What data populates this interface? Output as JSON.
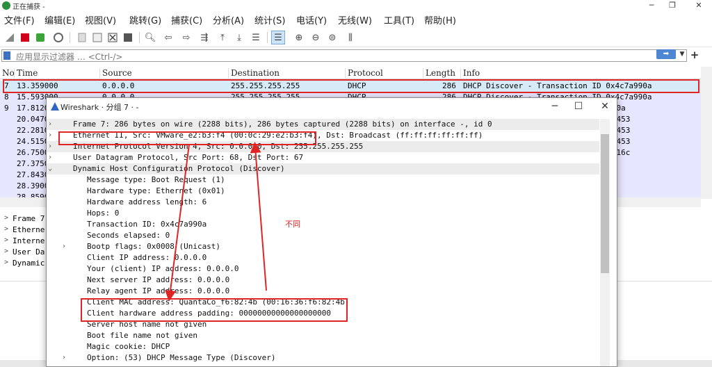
{
  "window": {
    "title": "正在捕获 -"
  },
  "menu": [
    {
      "label": "文件(F)"
    },
    {
      "label": "编辑(E)"
    },
    {
      "label": "视图(V)"
    },
    {
      "label": "跳转(G)"
    },
    {
      "label": "捕获(C)"
    },
    {
      "label": "分析(A)"
    },
    {
      "label": "统计(S)"
    },
    {
      "label": "电话(Y)"
    },
    {
      "label": "无线(W)"
    },
    {
      "label": "工具(T)"
    },
    {
      "label": "帮助(H)"
    }
  ],
  "filter": {
    "placeholder": "应用显示过滤器 … <Ctrl-/>"
  },
  "packet_list": {
    "columns": [
      "No",
      "Time",
      "Source",
      "Destination",
      "Protocol",
      "Length",
      "Info"
    ],
    "rows": [
      {
        "no": "7",
        "time": "13.359000",
        "src": "0.0.0.0",
        "dst": "255.255.255.255",
        "proto": "DHCP",
        "len": "286",
        "info": "DHCP Discover - Transaction ID 0x4c7a990a"
      },
      {
        "no": "8",
        "time": "15.593000",
        "src": "0.0.0.0",
        "dst": "255.255.255.255",
        "proto": "DHCP",
        "len": "286",
        "info": "DHCP Discover - Transaction ID 0x4c7a990a"
      },
      {
        "no": "9",
        "time": "17.8120",
        "src": "",
        "dst": "",
        "proto": "",
        "len": "",
        "info": "7a990a"
      },
      {
        "no": "",
        "time": "20.0470",
        "src": "",
        "dst": "",
        "proto": "",
        "len": "",
        "info": "54d3453"
      },
      {
        "no": "",
        "time": "22.2810",
        "src": "",
        "dst": "",
        "proto": "",
        "len": "",
        "info": "54d3453"
      },
      {
        "no": "",
        "time": "24.5150",
        "src": "",
        "dst": "",
        "proto": "",
        "len": "",
        "info": "54d3453"
      },
      {
        "no": "",
        "time": "26.7500",
        "src": "",
        "dst": "",
        "proto": "",
        "len": "",
        "info": "1c1416c"
      },
      {
        "no": "",
        "time": "27.3750",
        "src": "",
        "dst": "",
        "proto": "",
        "len": "",
        "info": ""
      },
      {
        "no": "",
        "time": "27.8430",
        "src": "",
        "dst": "",
        "proto": "",
        "len": "",
        "info": ""
      },
      {
        "no": "",
        "time": "28.3900",
        "src": "",
        "dst": "",
        "proto": "",
        "len": "",
        "info": ""
      },
      {
        "no": "",
        "time": "28.8590",
        "src": "",
        "dst": "",
        "proto": "",
        "len": "",
        "info": ""
      }
    ]
  },
  "details_bg": [
    {
      "label": "Frame 7"
    },
    {
      "label": "Etherne"
    },
    {
      "label": "Interne"
    },
    {
      "label": "User Da"
    },
    {
      "label": "Dynamic"
    }
  ],
  "dialog": {
    "title": "Wireshark · 分组 7 · -",
    "tree": [
      {
        "text": "Frame 7: 286 bytes on wire (2288 bits), 286 bytes captured (2288 bits) on interface -, id 0",
        "level": 0,
        "arrow": ">",
        "shade": true
      },
      {
        "text": "Ethernet II, Src: VMware_e2:b3:f4 (00:0c:29:e2:b3:f4), Dst: Broadcast (ff:ff:ff:ff:ff:ff)",
        "level": 0,
        "arrow": ">",
        "shade": false
      },
      {
        "text": "Internet Protocol Version 4, Src: 0.0.0.0, Dst: 255.255.255.255",
        "level": 0,
        "arrow": ">",
        "shade": true
      },
      {
        "text": "User Datagram Protocol, Src Port: 68, Dst Port: 67",
        "level": 0,
        "arrow": ">",
        "shade": false
      },
      {
        "text": "Dynamic Host Configuration Protocol (Discover)",
        "level": 0,
        "arrow": "v",
        "shade": true
      },
      {
        "text": "Message type: Boot Request (1)",
        "level": 1,
        "arrow": "",
        "shade": false
      },
      {
        "text": "Hardware type: Ethernet (0x01)",
        "level": 1,
        "arrow": "",
        "shade": false
      },
      {
        "text": "Hardware address length: 6",
        "level": 1,
        "arrow": "",
        "shade": false
      },
      {
        "text": "Hops: 0",
        "level": 1,
        "arrow": "",
        "shade": false
      },
      {
        "text": "Transaction ID: 0x4c7a990a",
        "level": 1,
        "arrow": "",
        "shade": false
      },
      {
        "text": "Seconds elapsed: 0",
        "level": 1,
        "arrow": "",
        "shade": false
      },
      {
        "text": "Bootp flags: 0x0008 (Unicast)",
        "level": 1,
        "arrow": ">",
        "shade": false
      },
      {
        "text": "Client IP address: 0.0.0.0",
        "level": 1,
        "arrow": "",
        "shade": false
      },
      {
        "text": "Your (client) IP address: 0.0.0.0",
        "level": 1,
        "arrow": "",
        "shade": false
      },
      {
        "text": "Next server IP address: 0.0.0.0",
        "level": 1,
        "arrow": "",
        "shade": false
      },
      {
        "text": "Relay agent IP address: 0.0.0.0",
        "level": 1,
        "arrow": "",
        "shade": false
      },
      {
        "text": "Client MAC address: QuantaCo_f6:82:4b (00:16:36:f6:82:4b)",
        "level": 1,
        "arrow": "",
        "shade": false
      },
      {
        "text": "Client hardware address padding: 00000000000000000000",
        "level": 1,
        "arrow": "",
        "shade": false
      },
      {
        "text": "Server host name not given",
        "level": 1,
        "arrow": "",
        "shade": false
      },
      {
        "text": "Boot file name not given",
        "level": 1,
        "arrow": "",
        "shade": false
      },
      {
        "text": "Magic cookie: DHCP",
        "level": 1,
        "arrow": "",
        "shade": false
      },
      {
        "text": "Option: (53) DHCP Message Type (Discover)",
        "level": 1,
        "arrow": ">",
        "shade": false
      }
    ]
  },
  "annotation": {
    "text": "不同",
    "color": "#e02424"
  },
  "colors": {
    "row_bg": "#e7e6ff",
    "selected_row_bg": "#d6eaf8",
    "accent": "#4d86d1"
  }
}
